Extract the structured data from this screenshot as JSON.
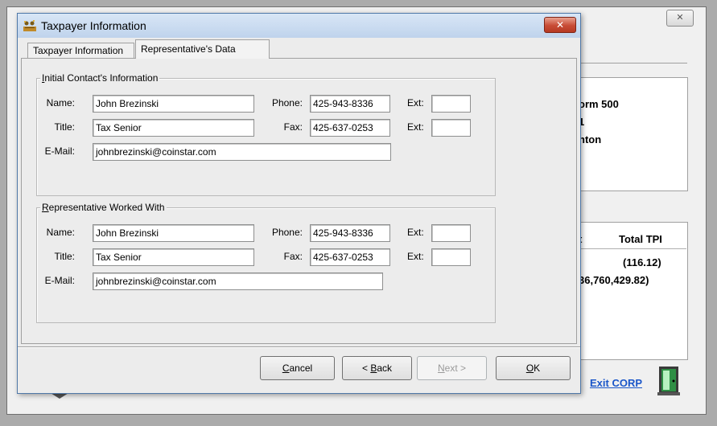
{
  "background_window": {
    "close_label": "✕",
    "panel1_lines": [
      "orm 500",
      "1",
      "nton"
    ],
    "panel2_headers": [
      "t",
      "Total TPI"
    ],
    "panel2_values": [
      "(116.12)",
      "36,760,429.82)"
    ],
    "exit_link": "Exit CORP"
  },
  "dialog": {
    "title": "Taxpayer Information",
    "close_label": "✕",
    "tabs": [
      {
        "label": "Taxpayer Information",
        "active": false
      },
      {
        "label": "Representative's Data",
        "active": true
      }
    ]
  },
  "initial_contact": {
    "legend_accel": "I",
    "legend_rest": "nitial Contact's Information",
    "name_label": "Name:",
    "name_value": "John Brezinski",
    "title_label": "Title:",
    "title_value": "Tax Senior",
    "email_label": "E-Mail:",
    "email_value": "johnbrezinski@coinstar.com",
    "phone_label": "Phone:",
    "phone_value": "425-943-8336",
    "fax_label": "Fax:",
    "fax_value": "425-637-0253",
    "ext_label": "Ext:",
    "phone_ext_value": "",
    "fax_ext_value": ""
  },
  "rep_worked_with": {
    "legend_accel": "R",
    "legend_rest": "epresentative Worked With",
    "name_label": "Name:",
    "name_value": "John Brezinski",
    "title_label": "Title:",
    "title_value": "Tax Senior",
    "email_label": "E-Mail:",
    "email_value": "johnbrezinski@coinstar.com",
    "phone_label": "Phone:",
    "phone_value": "425-943-8336",
    "fax_label": "Fax:",
    "fax_value": "425-637-0253",
    "ext_label": "Ext:",
    "phone_ext_value": "",
    "fax_ext_value": ""
  },
  "buttons": {
    "cancel_accel": "C",
    "cancel_rest": "ancel",
    "back_pre": "< ",
    "back_accel": "B",
    "back_rest": "ack",
    "next_accel": "N",
    "next_rest": "ext >",
    "ok_accel": "O",
    "ok_rest": "K"
  }
}
